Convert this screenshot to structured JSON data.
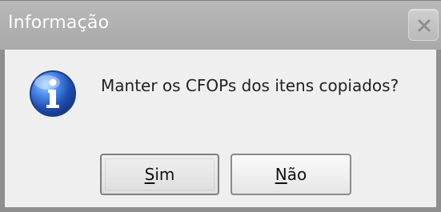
{
  "window": {
    "title": "Informação"
  },
  "dialog": {
    "message": "Manter os CFOPs dos itens copiados?",
    "icon_name": "info-icon"
  },
  "buttons": {
    "yes_label_prefix": "S",
    "yes_label_suffix": "im",
    "no_label_prefix": "N",
    "no_label_suffix": "ão"
  },
  "colors": {
    "titlebar": "#b0b0b0",
    "title_text": "#ffffff",
    "dialog_bg": "#efefef",
    "border": "#8f8f8f",
    "info_blue": "#2b63c6"
  }
}
